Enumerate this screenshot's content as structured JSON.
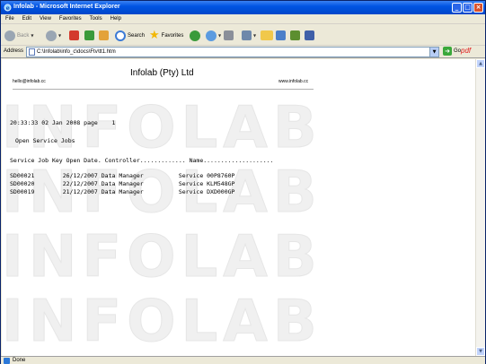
{
  "window": {
    "title": "Infolab - Microsoft Internet Explorer"
  },
  "menu": [
    "File",
    "Edit",
    "View",
    "Favorites",
    "Tools",
    "Help"
  ],
  "toolbar": {
    "back_label": "Back",
    "search_label": "Search",
    "favorites_label": "Favorites"
  },
  "address": {
    "label": "Address",
    "value": "C:\\Infolab\\info_c\\docs\\Ftv\\tt1.htm",
    "go_label": "Go",
    "pdf_label": "pdf"
  },
  "page": {
    "company": "Infolab (Pty) Ltd",
    "email": "hello@infolab.cc",
    "website": "www.infolab.cc",
    "watermark": "INFOLAB",
    "timestamp_line": "20:33:33 02 Jan 2008 page    1",
    "report_title": "Open Service Jobs",
    "header_line": "Service Job Key Open Date. Controller............. Name....................",
    "rows": [
      "SD00021        26/12/2007 Data Manager          Service 00P8760P",
      "SD00020        22/12/2007 Data Manager          Service KLM548GP",
      "SD00019        21/12/2007 Data Manager          Service DXD000GP"
    ]
  },
  "status": {
    "text": "Done"
  },
  "colors": {
    "titlebar": "#0054e3",
    "chrome": "#ece9d8",
    "watermark": "#f0f0f0"
  }
}
